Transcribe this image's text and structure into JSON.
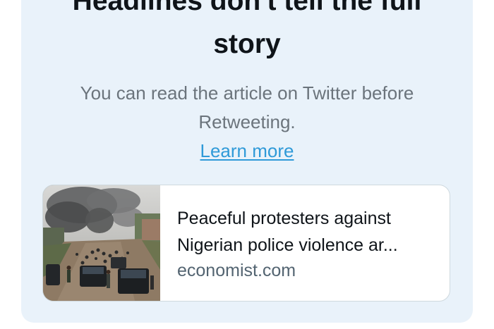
{
  "prompt": {
    "heading_line1": "Headlines don't tell the full",
    "heading_line2": "story",
    "subtext_line1": "You can read the article on Twitter before",
    "subtext_line2": "Retweeting.",
    "learn_more_label": "Learn more"
  },
  "article_card": {
    "title_line1": "Peaceful protesters against",
    "title_line2": "Nigerian police violence ar...",
    "domain": "economist.com",
    "thumbnail": "protest-street-smoke-image"
  },
  "colors": {
    "panel_background": "#e9f2fa",
    "heading_text": "#0f1419",
    "subtext": "#6b747c",
    "link": "#2f9ad8",
    "card_border": "#cfd9de",
    "domain_text": "#536471"
  }
}
